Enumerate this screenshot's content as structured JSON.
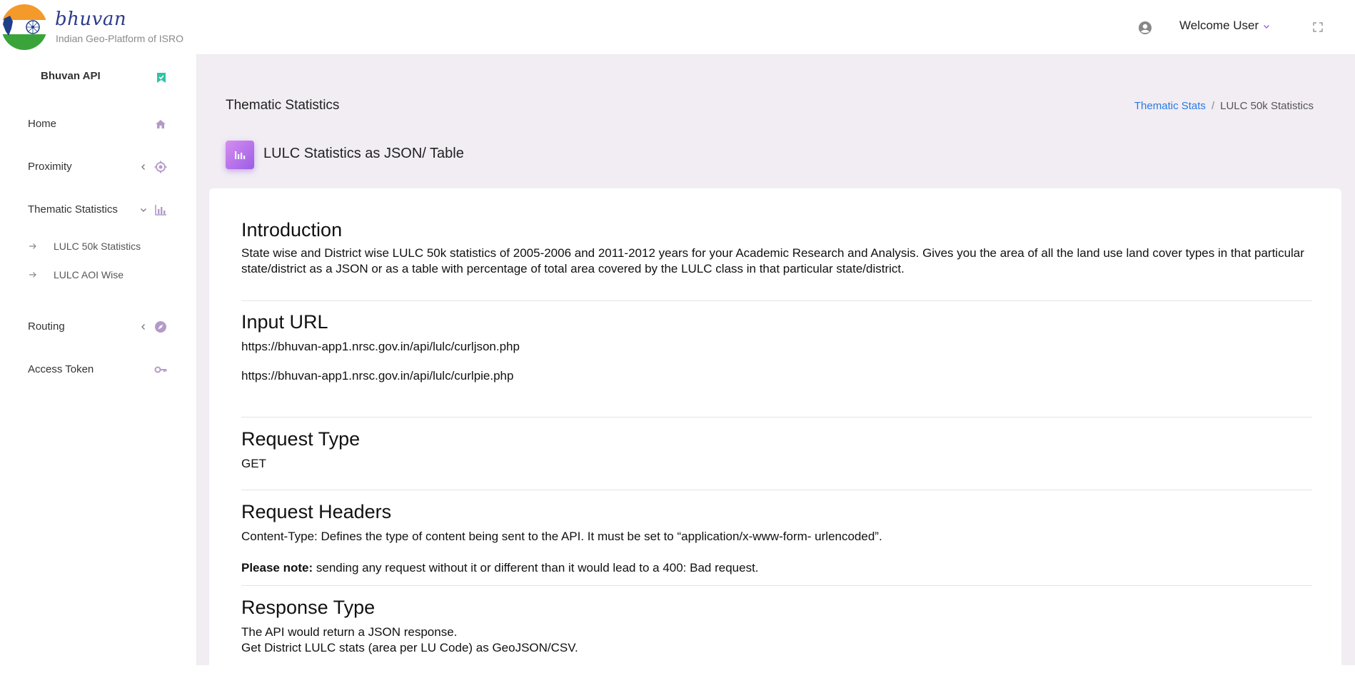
{
  "brand": {
    "name": "bhuvan",
    "tagline": "Indian Geo-Platform of ISRO"
  },
  "header": {
    "welcome": "Welcome User"
  },
  "sidebar": {
    "header": "Bhuvan API",
    "items": [
      {
        "label": "Home",
        "icon": "home-icon"
      },
      {
        "label": "Proximity",
        "icon": "target-icon"
      },
      {
        "label": "Thematic Statistics",
        "icon": "bar-chart-icon"
      },
      {
        "label": "Routing",
        "icon": "compass-icon"
      },
      {
        "label": "Access Token",
        "icon": "key-icon"
      }
    ],
    "subitems": [
      {
        "label": "LULC 50k Statistics"
      },
      {
        "label": "LULC AOI Wise"
      }
    ]
  },
  "page": {
    "title": "Thematic Statistics",
    "breadcrumb": {
      "link": "Thematic Stats",
      "separator": "/",
      "current": "LULC 50k Statistics"
    },
    "section_title": "LULC Statistics as JSON/ Table"
  },
  "content": {
    "intro": {
      "heading": "Introduction",
      "text": "State wise and District wise LULC 50k statistics of 2005-2006 and 2011-2012 years for your Academic Research and Analysis. Gives you the area of all the land use land cover types in that particular state/district as a JSON or as a table with percentage of total area covered by the LULC class in that particular state/district."
    },
    "input_url": {
      "heading": "Input URL",
      "urls": [
        "https://bhuvan-app1.nrsc.gov.in/api/lulc/curljson.php",
        "https://bhuvan-app1.nrsc.gov.in/api/lulc/curlpie.php"
      ]
    },
    "request_type": {
      "heading": "Request Type",
      "value": "GET"
    },
    "request_headers": {
      "heading": "Request Headers",
      "text": "Content-Type: Defines the type of content being sent to the API. It must be set to “application/x-www-form- urlencoded”.",
      "note_label": "Please note:",
      "note_text": " sending any request without it or different than it would lead to a 400: Bad request."
    },
    "response_type": {
      "heading": "Response Type",
      "line1": "The API would return a JSON response.",
      "line2": "Get District LULC stats (area per LU Code) as GeoJSON/CSV."
    }
  },
  "colors": {
    "accent": "#9b5de5",
    "sidebar_icon": "#b49ac8",
    "link": "#2a7ae2",
    "main_bg": "#f1edf3",
    "check_badge": "#2ec4a6"
  }
}
